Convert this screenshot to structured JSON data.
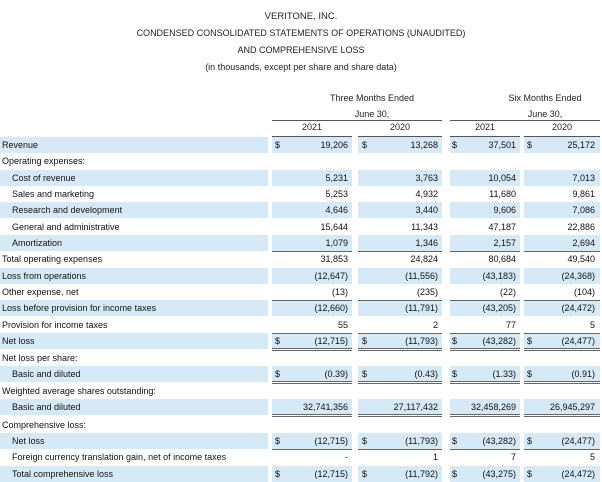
{
  "header": {
    "company": "VERITONE, INC.",
    "title_line1": "CONDENSED CONSOLIDATED STATEMENTS OF OPERATIONS (UNAUDITED)",
    "title_line2": "AND COMPREHENSIVE LOSS",
    "subtitle": "(in thousands, except per share and share data)"
  },
  "periods": {
    "three_months_line1": "Three Months Ended",
    "three_months_line2": "June 30,",
    "six_months_line1": "Six Months Ended",
    "six_months_line2": "June 30,"
  },
  "years": [
    "2021",
    "2020",
    "2021",
    "2020"
  ],
  "rows": [
    {
      "label": "Revenue",
      "indent": 0,
      "shade": true,
      "dollar": true,
      "values": [
        "19,206",
        "13,268",
        "37,501",
        "25,172"
      ]
    },
    {
      "label": "Operating expenses:",
      "indent": 0,
      "shade": false,
      "dollar": false,
      "values": [
        "",
        "",
        "",
        ""
      ]
    },
    {
      "label": "Cost of revenue",
      "indent": 1,
      "shade": true,
      "dollar": false,
      "values": [
        "5,231",
        "3,763",
        "10,054",
        "7,013"
      ]
    },
    {
      "label": "Sales and marketing",
      "indent": 1,
      "shade": false,
      "dollar": false,
      "values": [
        "5,253",
        "4,932",
        "11,680",
        "9,861"
      ]
    },
    {
      "label": "Research and development",
      "indent": 1,
      "shade": true,
      "dollar": false,
      "values": [
        "4,646",
        "3,440",
        "9,606",
        "7,086"
      ]
    },
    {
      "label": "General and administrative",
      "indent": 1,
      "shade": false,
      "dollar": false,
      "values": [
        "15,644",
        "11,343",
        "47,187",
        "22,886"
      ]
    },
    {
      "label": "Amortization",
      "indent": 1,
      "shade": true,
      "dollar": false,
      "values": [
        "1,079",
        "1,346",
        "2,157",
        "2,694"
      ]
    },
    {
      "label": "Total operating expenses",
      "indent": 0,
      "shade": false,
      "dollar": false,
      "values": [
        "31,853",
        "24,824",
        "80,684",
        "49,540"
      ]
    },
    {
      "label": "Loss from operations",
      "indent": 0,
      "shade": true,
      "dollar": false,
      "values": [
        "(12,647)",
        "(11,556)",
        "(43,183)",
        "(24,368)"
      ]
    },
    {
      "label": "Other expense, net",
      "indent": 0,
      "shade": false,
      "dollar": false,
      "values": [
        "(13)",
        "(235)",
        "(22)",
        "(104)"
      ]
    },
    {
      "label": "Loss before provision for income taxes",
      "indent": 0,
      "shade": true,
      "dollar": false,
      "values": [
        "(12,660)",
        "(11,791)",
        "(43,205)",
        "(24,472)"
      ]
    },
    {
      "label": "Provision for income taxes",
      "indent": 0,
      "shade": false,
      "dollar": false,
      "values": [
        "55",
        "2",
        "77",
        "5"
      ]
    },
    {
      "label": "Net loss",
      "indent": 0,
      "shade": true,
      "dollar": true,
      "values": [
        "(12,715)",
        "(11,793)",
        "(43,282)",
        "(24,477)"
      ]
    },
    {
      "label": "Net loss per share:",
      "indent": 0,
      "shade": false,
      "dollar": false,
      "values": [
        "",
        "",
        "",
        ""
      ]
    },
    {
      "label": "Basic and diluted",
      "indent": 1,
      "shade": true,
      "dollar": true,
      "values": [
        "(0.39)",
        "(0.43)",
        "(1.33)",
        "(0.91)"
      ]
    },
    {
      "label": "Weighted average shares outstanding:",
      "indent": 0,
      "shade": false,
      "dollar": false,
      "values": [
        "",
        "",
        "",
        ""
      ]
    },
    {
      "label": "Basic and diluted",
      "indent": 1,
      "shade": true,
      "dollar": false,
      "values": [
        "32,741,356",
        "27,117,432",
        "32,458,269",
        "26,945,297"
      ]
    },
    {
      "label": "Comprehensive loss:",
      "indent": 0,
      "shade": false,
      "dollar": false,
      "values": [
        "",
        "",
        "",
        ""
      ]
    },
    {
      "label": "Net loss",
      "indent": 1,
      "shade": true,
      "dollar": true,
      "values": [
        "(12,715)",
        "(11,793)",
        "(43,282)",
        "(24,477)"
      ]
    },
    {
      "label": "Foreign currency translation gain, net of income taxes",
      "indent": 1,
      "shade": false,
      "dollar": false,
      "values": [
        "-",
        "1",
        "7",
        "5"
      ]
    },
    {
      "label": "Total comprehensive loss",
      "indent": 1,
      "shade": true,
      "dollar": true,
      "values": [
        "(12,715)",
        "(11,792)",
        "(43,275)",
        "(24,472)"
      ]
    }
  ],
  "currency_symbol": "$"
}
